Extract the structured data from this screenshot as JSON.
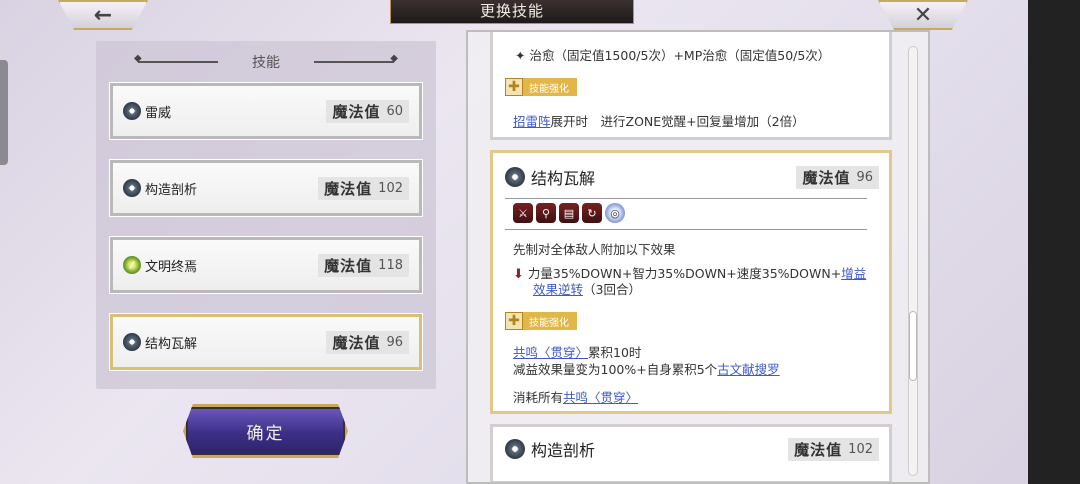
{
  "header": {
    "title": "更换技能",
    "back_icon": "←",
    "close_icon": "✕"
  },
  "left_panel": {
    "title": "技能",
    "skills": [
      {
        "name": "雷威",
        "mp_label": "魔法值",
        "mp": "60",
        "icon": "star-icon"
      },
      {
        "name": "构造剖析",
        "mp_label": "魔法值",
        "mp": "102",
        "icon": "star-icon"
      },
      {
        "name": "文明终焉",
        "mp_label": "魔法值",
        "mp": "118",
        "icon": "leaf-icon"
      },
      {
        "name": "结构瓦解",
        "mp_label": "魔法值",
        "mp": "96",
        "icon": "star-icon",
        "selected": true
      }
    ],
    "confirm_label": "确定"
  },
  "detail": {
    "prev_card": {
      "heal_line": "治愈（固定值1500/5次）+MP治愈（固定值50/5次）",
      "enhance_tag": "技能强化",
      "enhance_link": "招雷阵",
      "enhance_text": "展开时　进行ZONE觉醒+回复量增加（2倍）"
    },
    "main_card": {
      "name": "结构瓦解",
      "mp_label": "魔法值",
      "mp": "96",
      "effect_icons": [
        "sword-icon",
        "magnify-icon",
        "scroll-icon",
        "speed-icon",
        "orb-icon"
      ],
      "desc": "先制对全体敌人附加以下效果",
      "debuff_line1_text": "力量35%DOWN+智力35%DOWN+速度35%DOWN+",
      "debuff_line1_link": "增益",
      "debuff_line2_link": "效果逆转",
      "debuff_line2_text": "（3回合）",
      "enhance_tag": "技能强化",
      "resonance_link": "共鸣〈贯穿〉",
      "resonance_text": "累积10时",
      "reduce_text": "减益效果量变为100%+自身累积5个",
      "reduce_link": "古文献搜罗",
      "consume_text": "消耗所有",
      "consume_link": "共鸣〈贯穿〉"
    },
    "next_card": {
      "name": "构造剖析",
      "mp_label": "魔法值",
      "mp": "102"
    }
  }
}
